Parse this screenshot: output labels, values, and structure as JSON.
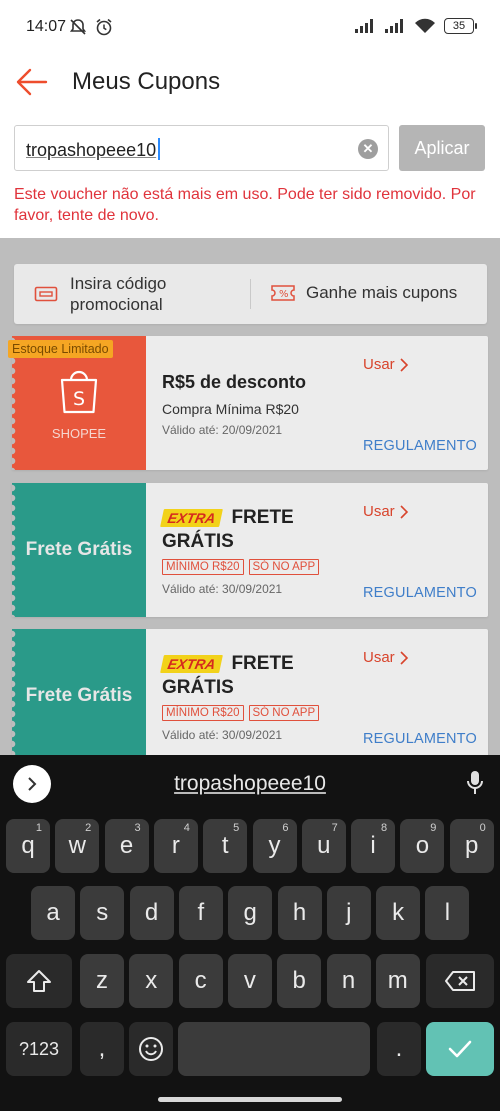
{
  "status_bar": {
    "time": "14:07",
    "battery": "35"
  },
  "header": {
    "title": "Meus Cupons"
  },
  "code_input": {
    "value": "tropashopeee10"
  },
  "apply_button": "Aplicar",
  "error_message": "Este voucher não está mais em uso. Pode ter sido removido. Por favor, tente de novo.",
  "options": {
    "insert_code": "Insira código promocional",
    "earn_more": "Ganhe mais cupons"
  },
  "vouchers": [
    {
      "badge": "Estoque Limitado",
      "brand": "SHOPEE",
      "title": "R$5 de desconto",
      "subtitle": "Compra Mínima R$20",
      "valid": "Válido até: 20/09/2021",
      "use": "Usar",
      "terms": "REGULAMENTO",
      "color": "#e8573c"
    },
    {
      "left_label": "Frete Grátis",
      "logo": "EXTRA",
      "title_1": "FRETE",
      "title_2": "GRÁTIS",
      "tags": [
        "MÍNIMO R$20",
        "SÓ NO APP"
      ],
      "valid": "Válido até: 30/09/2021",
      "use": "Usar",
      "terms": "REGULAMENTO",
      "color": "#2a9a89"
    },
    {
      "left_label": "Frete Grátis",
      "logo": "EXTRA",
      "title_1": "FRETE",
      "title_2": "GRÁTIS",
      "tags": [
        "MÍNIMO R$20",
        "SÓ NO APP"
      ],
      "valid": "Válido até: 30/09/2021",
      "use": "Usar",
      "terms": "REGULAMENTO",
      "color": "#2a9a89"
    }
  ],
  "keyboard": {
    "suggestion": "tropashopeee10",
    "row1": [
      {
        "k": "q",
        "h": "1"
      },
      {
        "k": "w",
        "h": "2"
      },
      {
        "k": "e",
        "h": "3"
      },
      {
        "k": "r",
        "h": "4"
      },
      {
        "k": "t",
        "h": "5"
      },
      {
        "k": "y",
        "h": "6"
      },
      {
        "k": "u",
        "h": "7"
      },
      {
        "k": "i",
        "h": "8"
      },
      {
        "k": "o",
        "h": "9"
      },
      {
        "k": "p",
        "h": "0"
      }
    ],
    "row2": [
      "a",
      "s",
      "d",
      "f",
      "g",
      "h",
      "j",
      "k",
      "l"
    ],
    "row3": [
      "z",
      "x",
      "c",
      "v",
      "b",
      "n",
      "m"
    ],
    "symbols": "?123",
    "comma": ",",
    "period": "."
  },
  "colors": {
    "accent": "#ee4d2d",
    "error": "#e0333b",
    "link": "#3f7ec9",
    "enter": "#62c2b4"
  }
}
